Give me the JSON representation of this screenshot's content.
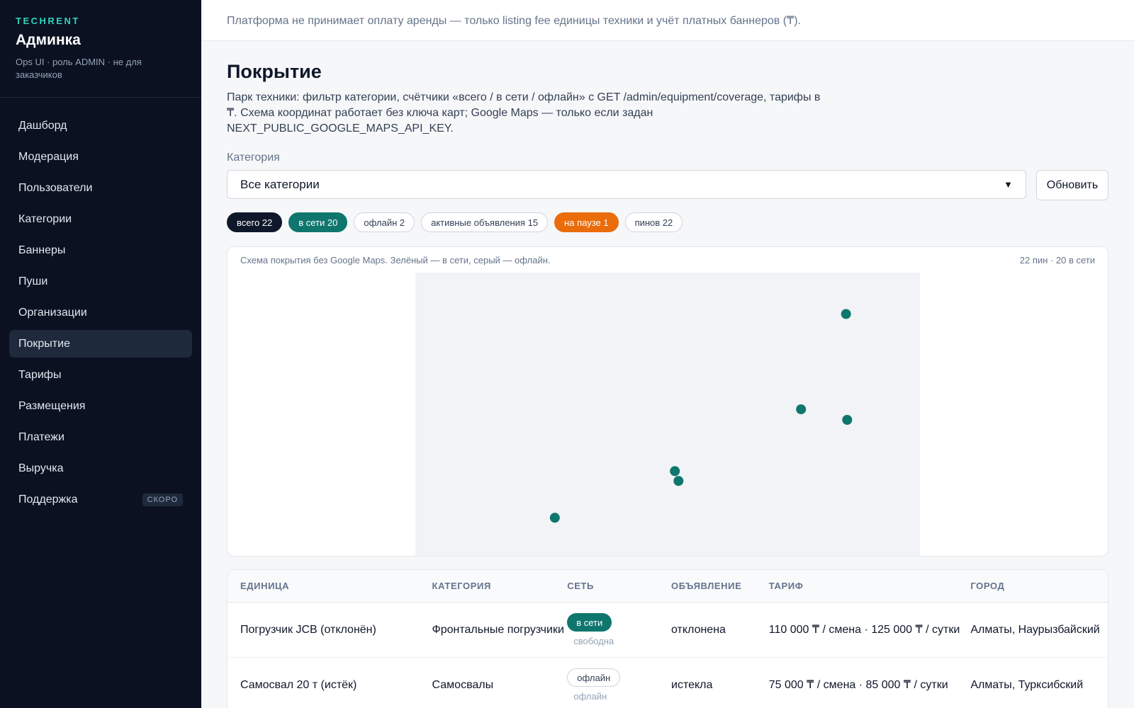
{
  "banner": "Платформа не принимает оплату аренды — только listing fee единицы техники и учёт платных баннеров (₸).",
  "brand": {
    "kicker": "TECHRENT",
    "title": "Админка",
    "subtitle": "Ops UI · роль ADMIN · не для заказчиков"
  },
  "nav": {
    "items": [
      {
        "label": "Дашборд"
      },
      {
        "label": "Модерация"
      },
      {
        "label": "Пользователи"
      },
      {
        "label": "Категории"
      },
      {
        "label": "Баннеры"
      },
      {
        "label": "Пуши"
      },
      {
        "label": "Организации"
      },
      {
        "label": "Покрытие",
        "active": true
      },
      {
        "label": "Тарифы"
      },
      {
        "label": "Размещения"
      },
      {
        "label": "Платежи"
      },
      {
        "label": "Выручка"
      },
      {
        "label": "Поддержка",
        "badge": "СКОРО"
      }
    ]
  },
  "page": {
    "title": "Покрытие",
    "description": "Парк техники: фильтр категории, счётчики «всего / в сети / офлайн» с GET /admin/equipment/coverage, тарифы в ₸. Схема координат работает без ключа карт; Google Maps — только если задан NEXT_PUBLIC_GOOGLE_MAPS_API_KEY."
  },
  "filter": {
    "label": "Категория",
    "selected": "Все категории",
    "refresh_label": "Обновить"
  },
  "chips": {
    "total": "всего 22",
    "online": "в сети 20",
    "offline": "офлайн 2",
    "active_listings": "активные объявления 15",
    "paused": "на паузе 1",
    "pins": "пинов 22"
  },
  "map": {
    "caption": "Схема покрытия без Google Maps. Зелёный — в сети, серый — офлайн.",
    "summary": "22 пин · 20 в сети",
    "colors": {
      "online": "#0f766e",
      "offline": "#94a3b8",
      "region": "#f1f3f6"
    },
    "pins": [
      {
        "lon": 76.95,
        "lat": 43.3,
        "status": "online"
      },
      {
        "lon": 75.7,
        "lat": 41.85,
        "status": "online"
      },
      {
        "lon": 76.98,
        "lat": 41.69,
        "status": "online"
      },
      {
        "lon": 72.2,
        "lat": 40.91,
        "status": "online"
      },
      {
        "lon": 72.3,
        "lat": 40.76,
        "status": "online"
      },
      {
        "lon": 68.87,
        "lat": 40.2,
        "status": "online"
      }
    ]
  },
  "table": {
    "headers": [
      "ЕДИНИЦА",
      "КАТЕГОРИЯ",
      "СЕТЬ",
      "ОБЪЯВЛЕНИЕ",
      "ТАРИФ",
      "ГОРОД"
    ],
    "rows": [
      {
        "unit": "Погрузчик JCB (отклонён)",
        "category": "Фронтальные погрузчики",
        "network": "в сети",
        "network_status": "online",
        "network_sub": "свободна",
        "listing": "отклонена",
        "tariff": "110 000 ₸ / смена · 125 000 ₸ / сутки",
        "city": "Алматы, Наурызбайский"
      },
      {
        "unit": "Самосвал 20 т (истёк)",
        "category": "Самосвалы",
        "network": "офлайн",
        "network_status": "offline",
        "network_sub": "офлайн",
        "listing": "истекла",
        "tariff": "75 000 ₸ / смена · 85 000 ₸ / сутки",
        "city": "Алматы, Турксибский"
      }
    ]
  }
}
